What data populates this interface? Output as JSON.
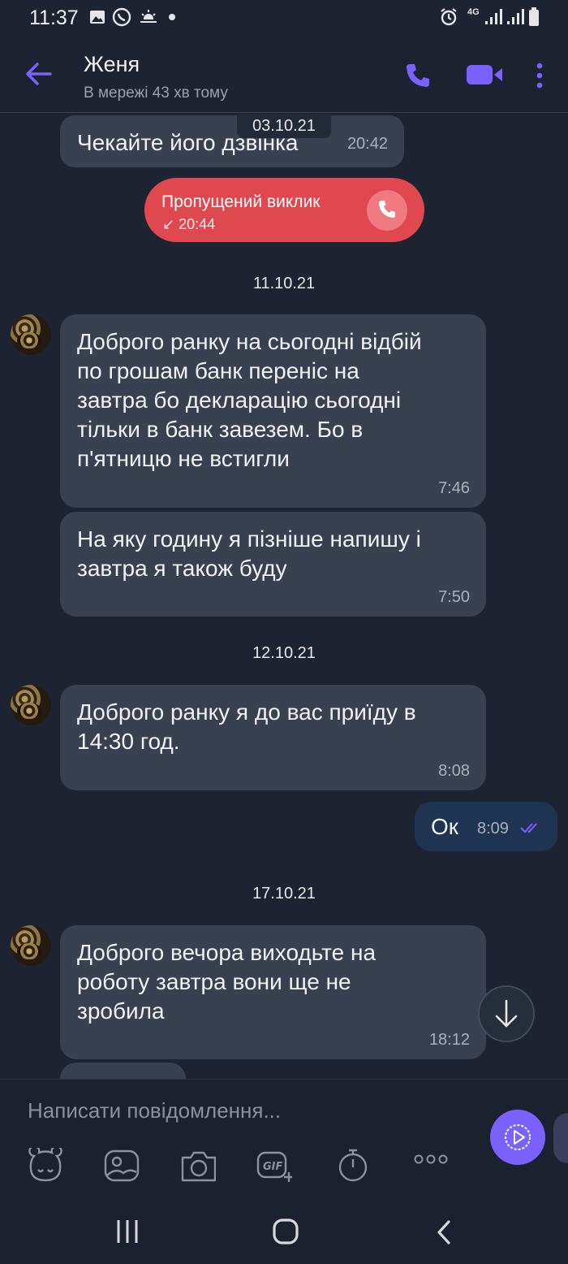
{
  "status_bar": {
    "time": "11:37",
    "network": "4G"
  },
  "header": {
    "contact_name": "Женя",
    "last_seen": "В мережі 43 хв тому"
  },
  "colors": {
    "accent": "#7b61ff",
    "missed_call": "#e0484f",
    "outgoing_bubble": "#1f3352",
    "incoming_bubble": "#394150",
    "background": "#1d2331"
  },
  "messages": {
    "m1": {
      "text": "Чекайте його дзвінка",
      "time": "20:42",
      "overlay_date": "03.10.21"
    },
    "missed_call": {
      "label": "Пропущений виклик",
      "time": "↙ 20:44"
    },
    "date2": "11.10.21",
    "m2": {
      "text": "Доброго ранку на сьогодні відбій\nпо грошам банк переніс на\nзавтра бо декларацію сьогодні\nтільки в банк завезем. Бо в\nп'ятницю не встигли",
      "time": "7:46"
    },
    "m3": {
      "text": "На яку годину я пізніше напишу і\nзавтра я також буду",
      "time": "7:50"
    },
    "date3": "12.10.21",
    "m4": {
      "text": "Доброго ранку я до вас приїду в\n14:30 год.",
      "time": "8:08"
    },
    "m5": {
      "text": "Ок",
      "time": "8:09"
    },
    "date4": "17.10.21",
    "m6": {
      "text": "Доброго вечора виходьте на\nроботу завтра вони ще не\nзробила",
      "time": "18:12"
    }
  },
  "composer": {
    "placeholder": "Написати повідомлення...",
    "tools": [
      "sticker-icon",
      "gallery-icon",
      "camera-icon",
      "gif-icon",
      "timer-icon",
      "more-icon"
    ]
  }
}
